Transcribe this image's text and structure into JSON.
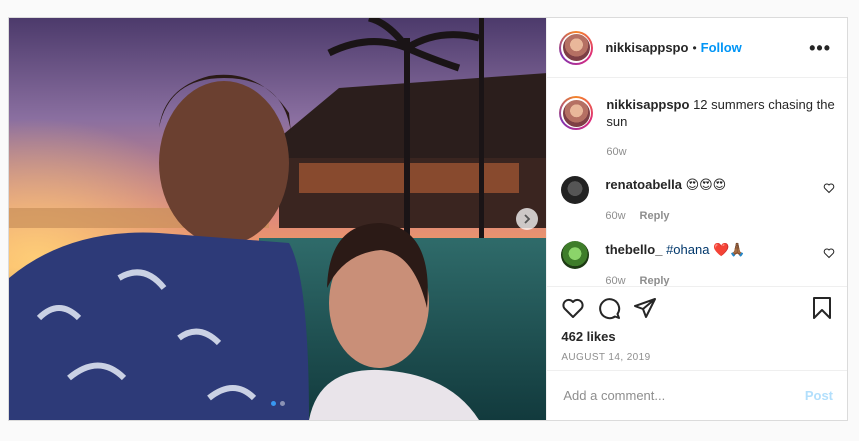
{
  "post": {
    "username": "nikkisappspo",
    "separator": "•",
    "follow_label": "Follow",
    "more_icon": "more-horizontal-icon",
    "caption": {
      "username": "nikkisappspo",
      "text": "12 summers chasing the sun",
      "time": "60w"
    },
    "comments": [
      {
        "username": "renatoabella",
        "text": "😍😍😍",
        "time": "60w",
        "reply_label": "Reply"
      },
      {
        "username": "thebello_",
        "hashtag": "#ohana",
        "emoji": "❤️🙏🏾",
        "time": "60w",
        "reply_label": "Reply"
      }
    ],
    "likes": "462 likes",
    "date": "AUGUST 14, 2019",
    "comment_placeholder": "Add a comment...",
    "post_label": "Post",
    "carousel": {
      "current": 1,
      "total": 2
    },
    "colors": {
      "accent": "#0095f6",
      "post_disabled": "#b2dffc",
      "hashtag": "#00376b"
    }
  }
}
